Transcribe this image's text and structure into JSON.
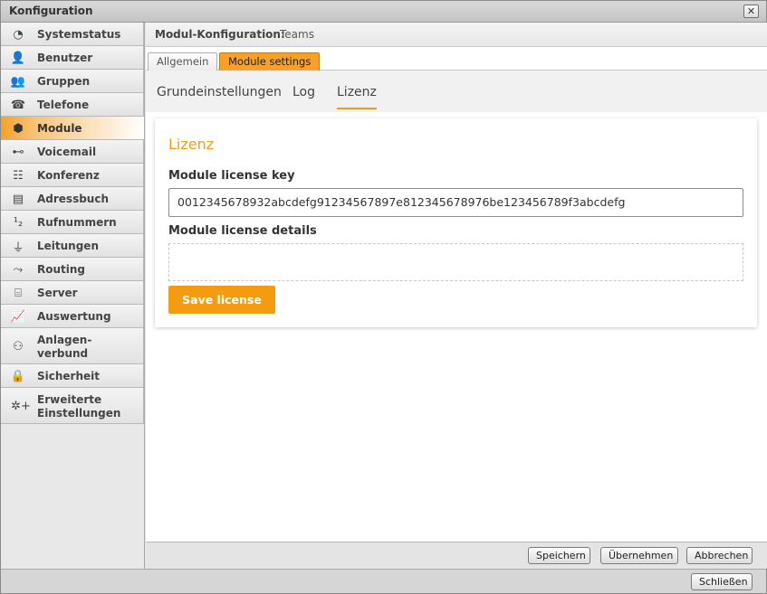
{
  "window": {
    "title": "Konfiguration",
    "close_label": "✕"
  },
  "sidebar": {
    "items": [
      {
        "label": "Systemstatus",
        "icon": "clock-icon",
        "glyph": "◔"
      },
      {
        "label": "Benutzer",
        "icon": "user-icon",
        "glyph": "👤"
      },
      {
        "label": "Gruppen",
        "icon": "group-icon",
        "glyph": "👥"
      },
      {
        "label": "Telefone",
        "icon": "phone-icon",
        "glyph": "☎"
      },
      {
        "label": "Module",
        "icon": "cube-icon",
        "glyph": "⬢"
      },
      {
        "label": "Voicemail",
        "icon": "voicemail-icon",
        "glyph": "⊷"
      },
      {
        "label": "Konferenz",
        "icon": "conference-icon",
        "glyph": "☷"
      },
      {
        "label": "Adressbuch",
        "icon": "addressbook-icon",
        "glyph": "▤"
      },
      {
        "label": "Rufnummern",
        "icon": "numbers-icon",
        "glyph": "¹₂"
      },
      {
        "label": "Leitungen",
        "icon": "plug-icon",
        "glyph": "⏚"
      },
      {
        "label": "Routing",
        "icon": "routing-icon",
        "glyph": "⤳"
      },
      {
        "label": "Server",
        "icon": "server-icon",
        "glyph": "⌸"
      },
      {
        "label": "Auswertung",
        "icon": "chart-icon",
        "glyph": "📈"
      },
      {
        "label": "Anlagen-\nverbund",
        "icon": "network-icon",
        "glyph": "⚇"
      },
      {
        "label": "Sicherheit",
        "icon": "lock-icon",
        "glyph": "🔒"
      },
      {
        "label": "Erweiterte\nEinstellungen",
        "icon": "gear-plus-icon",
        "glyph": "✲+"
      }
    ]
  },
  "header": {
    "label": "Modul-Konfiguration:",
    "value": "Teams"
  },
  "tabs": [
    {
      "label": "Allgemein"
    },
    {
      "label": "Module settings"
    }
  ],
  "subtabs": [
    {
      "label": "Grundeinstellungen"
    },
    {
      "label": "Log"
    },
    {
      "label": "Lizenz"
    }
  ],
  "license": {
    "title": "Lizenz",
    "key_label": "Module license key",
    "key_value": "0012345678932abcdefg91234567897e812345678976be123456789f3abcdefg",
    "details_label": "Module license details",
    "details_value": "",
    "save_label": "Save license"
  },
  "footer": {
    "save_label": "Speichern",
    "apply_label": "Übernehmen",
    "cancel_label": "Abbrechen"
  },
  "bottombar": {
    "close_label": "Schließen"
  },
  "colors": {
    "accent": "#f39c12",
    "tab_active": "#f6a12b"
  }
}
